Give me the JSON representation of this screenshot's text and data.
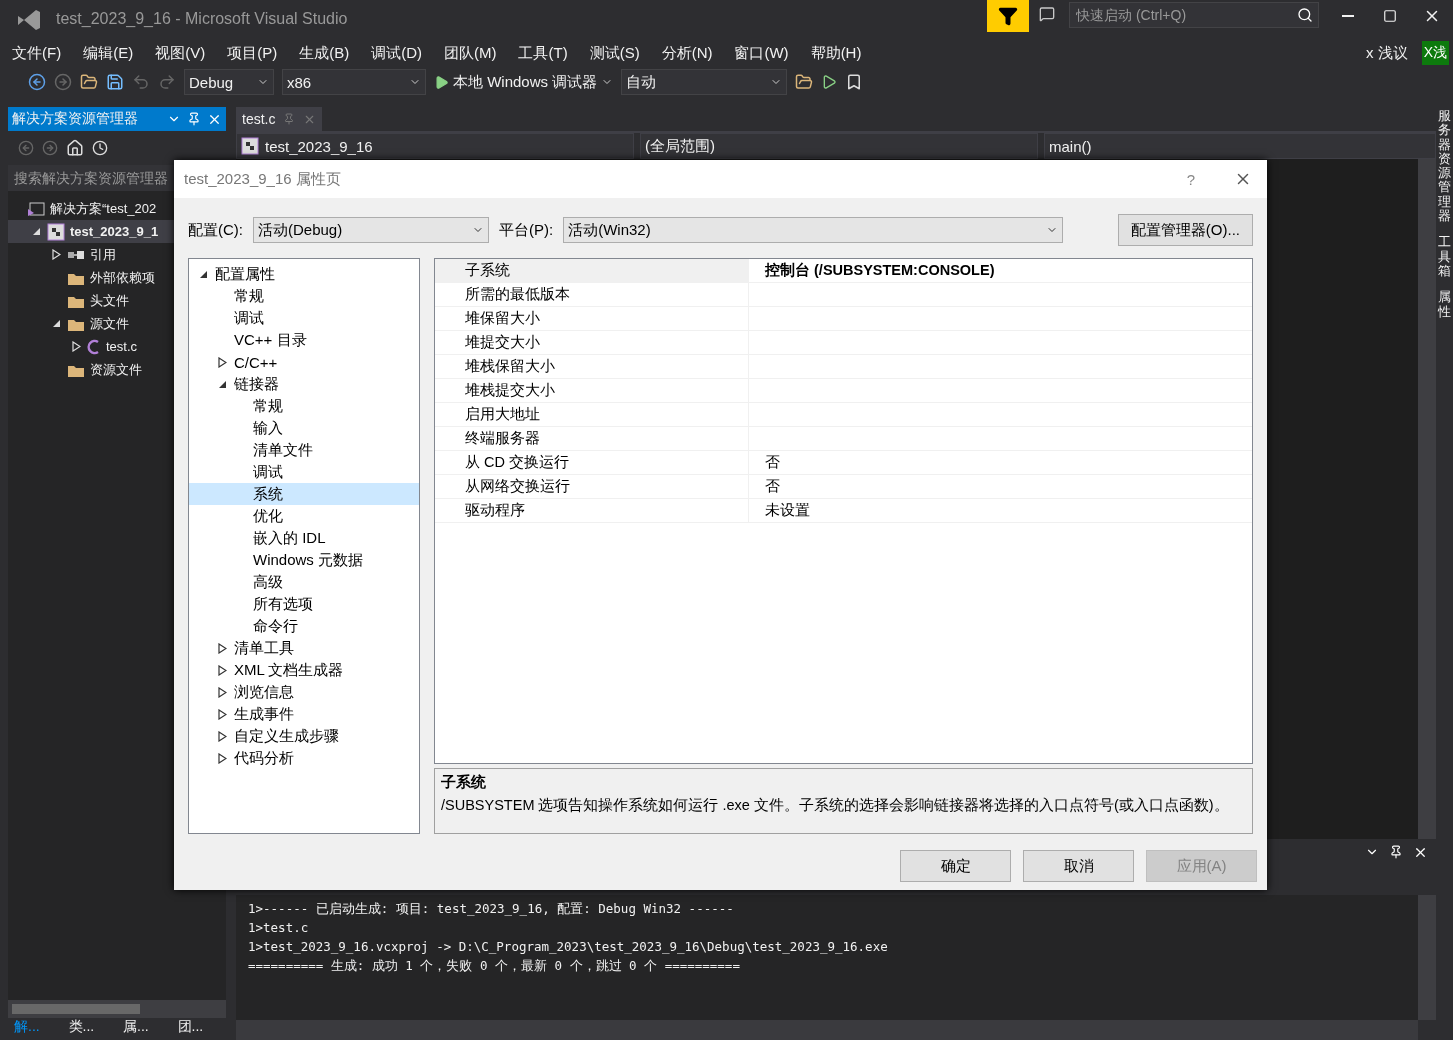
{
  "window": {
    "title": "test_2023_9_16 - Microsoft Visual Studio",
    "quick_launch": {
      "placeholder": "快速启动 (Ctrl+Q)"
    },
    "user": "x 浅议",
    "avatar": "X浅"
  },
  "menu": [
    "文件(F)",
    "编辑(E)",
    "视图(V)",
    "项目(P)",
    "生成(B)",
    "调试(D)",
    "团队(M)",
    "工具(T)",
    "测试(S)",
    "分析(N)",
    "窗口(W)",
    "帮助(H)"
  ],
  "toolbar": {
    "configuration": "Debug",
    "platform": "x86",
    "debugger": "本地 Windows 调试器",
    "target": "自动"
  },
  "solution_explorer": {
    "title": "解决方案资源管理器",
    "search": {
      "placeholder": "搜索解决方案资源管理器"
    },
    "tree": [
      {
        "label": "解决方案“test_202",
        "kind": "solution",
        "selected": false,
        "children": [
          {
            "label": "test_2023_9_1",
            "kind": "project",
            "expanded": true,
            "selected": true,
            "children": [
              {
                "label": "引用",
                "kind": "references",
                "expanded": false,
                "selected": false
              },
              {
                "label": "外部依赖项",
                "kind": "folder",
                "selected": false
              },
              {
                "label": "头文件",
                "kind": "folder",
                "selected": false
              },
              {
                "label": "源文件",
                "kind": "folder",
                "expanded": true,
                "selected": false,
                "children": [
                  {
                    "label": "test.c",
                    "kind": "cfile",
                    "expanded": false,
                    "selected": false
                  }
                ]
              },
              {
                "label": "资源文件",
                "kind": "folder",
                "selected": false
              }
            ]
          }
        ]
      }
    ],
    "tabs": [
      {
        "label": "解...",
        "selected": true
      },
      {
        "label": "类...",
        "selected": false
      },
      {
        "label": "属...",
        "selected": false
      },
      {
        "label": "团...",
        "selected": false
      }
    ]
  },
  "editor": {
    "tabs": [
      {
        "label": "test.c",
        "selected": true
      }
    ],
    "nav": {
      "project": "test_2023_9_16",
      "scope": "(全局范围)",
      "member": "main()"
    }
  },
  "output": {
    "lines": [
      "1>------ 已启动生成: 项目: test_2023_9_16, 配置: Debug Win32 ------",
      "1>test.c",
      "1>test_2023_9_16.vcxproj -> D:\\C_Program_2023\\test_2023_9_16\\Debug\\test_2023_9_16.exe",
      "========== 生成: 成功 1 个，失败 0 个，最新 0 个，跳过 0 个 =========="
    ]
  },
  "side_tabs": [
    "服务器资源管理器",
    "工具箱",
    "属性"
  ],
  "dialog": {
    "title": "test_2023_9_16 属性页",
    "help": "?",
    "config_label": "配置(C):",
    "config_value": "活动(Debug)",
    "platform_label": "平台(P):",
    "platform_value": "活动(Win32)",
    "manager_button": "配置管理器(O)...",
    "tree": [
      {
        "label": "配置属性",
        "expanded": true,
        "selected": false,
        "children": [
          {
            "label": "常规",
            "selected": false
          },
          {
            "label": "调试",
            "selected": false
          },
          {
            "label": "VC++ 目录",
            "selected": false
          },
          {
            "label": "C/C++",
            "expanded": false,
            "selected": false
          },
          {
            "label": "链接器",
            "expanded": true,
            "selected": false,
            "children": [
              {
                "label": "常规",
                "selected": false
              },
              {
                "label": "输入",
                "selected": false
              },
              {
                "label": "清单文件",
                "selected": false
              },
              {
                "label": "调试",
                "selected": false
              },
              {
                "label": "系统",
                "selected": true
              },
              {
                "label": "优化",
                "selected": false
              },
              {
                "label": "嵌入的 IDL",
                "selected": false
              },
              {
                "label": "Windows 元数据",
                "selected": false
              },
              {
                "label": "高级",
                "selected": false
              },
              {
                "label": "所有选项",
                "selected": false
              },
              {
                "label": "命令行",
                "selected": false
              }
            ]
          },
          {
            "label": "清单工具",
            "expanded": false,
            "selected": false
          },
          {
            "label": "XML 文档生成器",
            "expanded": false,
            "selected": false
          },
          {
            "label": "浏览信息",
            "expanded": false,
            "selected": false
          },
          {
            "label": "生成事件",
            "expanded": false,
            "selected": false
          },
          {
            "label": "自定义生成步骤",
            "expanded": false,
            "selected": false
          },
          {
            "label": "代码分析",
            "expanded": false,
            "selected": false
          }
        ]
      }
    ],
    "properties": [
      {
        "name": "子系统",
        "value": "控制台 (/SUBSYSTEM:CONSOLE)",
        "selected": true
      },
      {
        "name": "所需的最低版本",
        "selected": false
      },
      {
        "name": "堆保留大小",
        "selected": false
      },
      {
        "name": "堆提交大小",
        "selected": false
      },
      {
        "name": "堆栈保留大小",
        "selected": false
      },
      {
        "name": "堆栈提交大小",
        "selected": false
      },
      {
        "name": "启用大地址",
        "selected": false
      },
      {
        "name": "终端服务器",
        "selected": false
      },
      {
        "name": "从 CD 交换运行",
        "value": "否",
        "selected": false
      },
      {
        "name": "从网络交换运行",
        "value": "否",
        "selected": false
      },
      {
        "name": "驱动程序",
        "value": "未设置",
        "selected": false
      }
    ],
    "description": {
      "title": "子系统",
      "text": "/SUBSYSTEM 选项告知操作系统如何运行 .exe 文件。子系统的选择会影响链接器将选择的入口点符号(或入口点函数)。"
    },
    "buttons": [
      {
        "label": "确定",
        "disabled": false
      },
      {
        "label": "取消",
        "disabled": false
      },
      {
        "label": "应用(A)",
        "disabled": true
      }
    ]
  }
}
